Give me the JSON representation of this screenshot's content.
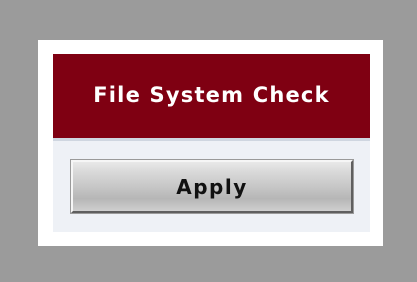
{
  "panel": {
    "title": "File System Check",
    "apply_label": "Apply"
  },
  "colors": {
    "background": "#9b9b9b",
    "header": "#7f0012",
    "body": "#eef1f6",
    "button": "#c7c7c7"
  }
}
